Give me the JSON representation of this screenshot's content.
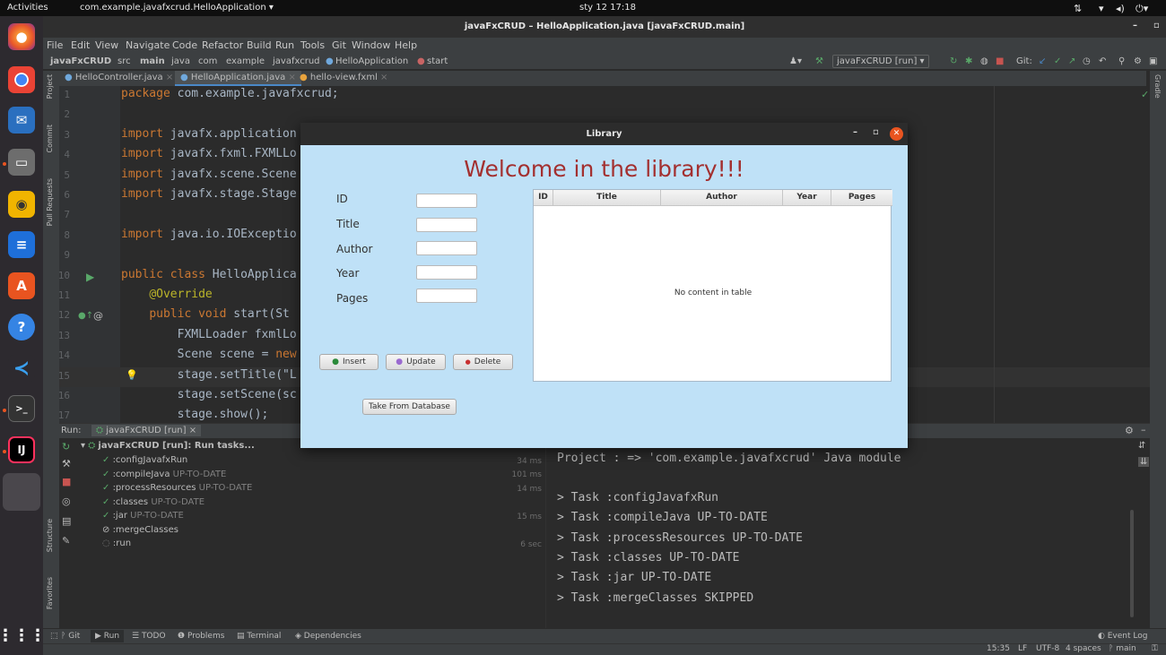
{
  "topbar": {
    "activities": "Activities",
    "app": "com.example.javafxcrud.HelloApplication",
    "clock": "sty 12  17:18"
  },
  "window_title": "javaFxCRUD – HelloApplication.java [javaFxCRUD.main]",
  "menu": [
    "File",
    "Edit",
    "View",
    "Navigate",
    "Code",
    "Refactor",
    "Build",
    "Run",
    "Tools",
    "Git",
    "Window",
    "Help"
  ],
  "breadcrumbs": [
    "javaFxCRUD",
    "src",
    "main",
    "java",
    "com",
    "example",
    "javafxcrud",
    "HelloApplication",
    "start"
  ],
  "run_config": "javaFxCRUD [run]",
  "git_label": "Git:",
  "tabs": [
    "HelloController.java",
    "HelloApplication.java",
    "hello-view.fxml"
  ],
  "side_left": {
    "project": "Project",
    "commit": "Commit",
    "pull": "Pull Requests",
    "structure": "Structure",
    "favorites": "Favorites"
  },
  "side_right": {
    "gradle": "Gradle"
  },
  "code_lines": [
    {
      "n": "1",
      "t": "package com.example.javafxcrud;"
    },
    {
      "n": "2",
      "t": ""
    },
    {
      "n": "3",
      "t": "import javafx.application"
    },
    {
      "n": "4",
      "t": "import javafx.fxml.FXMLLo"
    },
    {
      "n": "5",
      "t": "import javafx.scene.Scene"
    },
    {
      "n": "6",
      "t": "import javafx.stage.Stage"
    },
    {
      "n": "7",
      "t": ""
    },
    {
      "n": "8",
      "t": "import java.io.IOExceptio"
    },
    {
      "n": "9",
      "t": ""
    },
    {
      "n": "10",
      "t": "public class HelloApplica"
    },
    {
      "n": "11",
      "t": "    @Override"
    },
    {
      "n": "12",
      "t": "    public void start(St"
    },
    {
      "n": "13",
      "t": "        FXMLLoader fxmlLo"
    },
    {
      "n": "14",
      "t": "        Scene scene = new"
    },
    {
      "n": "15",
      "t": "        stage.setTitle(\"L"
    },
    {
      "n": "16",
      "t": "        stage.setScene(sc"
    },
    {
      "n": "17",
      "t": "        stage.show();"
    }
  ],
  "run": {
    "label": "Run:",
    "tab": "javaFxCRUD [run]",
    "root": "javaFxCRUD [run]: Run tasks...",
    "tasks": [
      {
        "name": ":configJavafxRun",
        "status": "",
        "time": "34 ms",
        "done": true
      },
      {
        "name": ":compileJava",
        "status": "UP-TO-DATE",
        "time": "101 ms",
        "done": true
      },
      {
        "name": ":processResources",
        "status": "UP-TO-DATE",
        "time": "14 ms",
        "done": true
      },
      {
        "name": ":classes",
        "status": "UP-TO-DATE",
        "time": "",
        "done": true
      },
      {
        "name": ":jar",
        "status": "UP-TO-DATE",
        "time": "15 ms",
        "done": true
      },
      {
        "name": ":mergeClasses",
        "status": "",
        "time": "",
        "done": false
      },
      {
        "name": ":run",
        "status": "",
        "time": "6 sec",
        "done": false
      }
    ],
    "console": [
      "Project : => 'com.example.javafxcrud' Java module",
      "",
      "> Task :configJavafxRun",
      "> Task :compileJava UP-TO-DATE",
      "> Task :processResources UP-TO-DATE",
      "> Task :classes UP-TO-DATE",
      "> Task :jar UP-TO-DATE",
      "> Task :mergeClasses SKIPPED"
    ]
  },
  "bottom_tabs": [
    "Git",
    "Run",
    "TODO",
    "Problems",
    "Terminal",
    "Dependencies"
  ],
  "event_log": "Event Log",
  "status": {
    "pos": "15:35",
    "lf": "LF",
    "enc": "UTF-8",
    "indent": "4 spaces",
    "branch": "main"
  },
  "library": {
    "title": "Library",
    "heading": "Welcome in the library!!!",
    "fields": [
      "ID",
      "Title",
      "Author",
      "Year",
      "Pages"
    ],
    "buttons": {
      "insert": "Insert",
      "update": "Update",
      "delete": "Delete",
      "take": "Take From Database"
    },
    "columns": [
      "ID",
      "Title",
      "Author",
      "Year",
      "Pages"
    ],
    "empty": "No content in table"
  }
}
